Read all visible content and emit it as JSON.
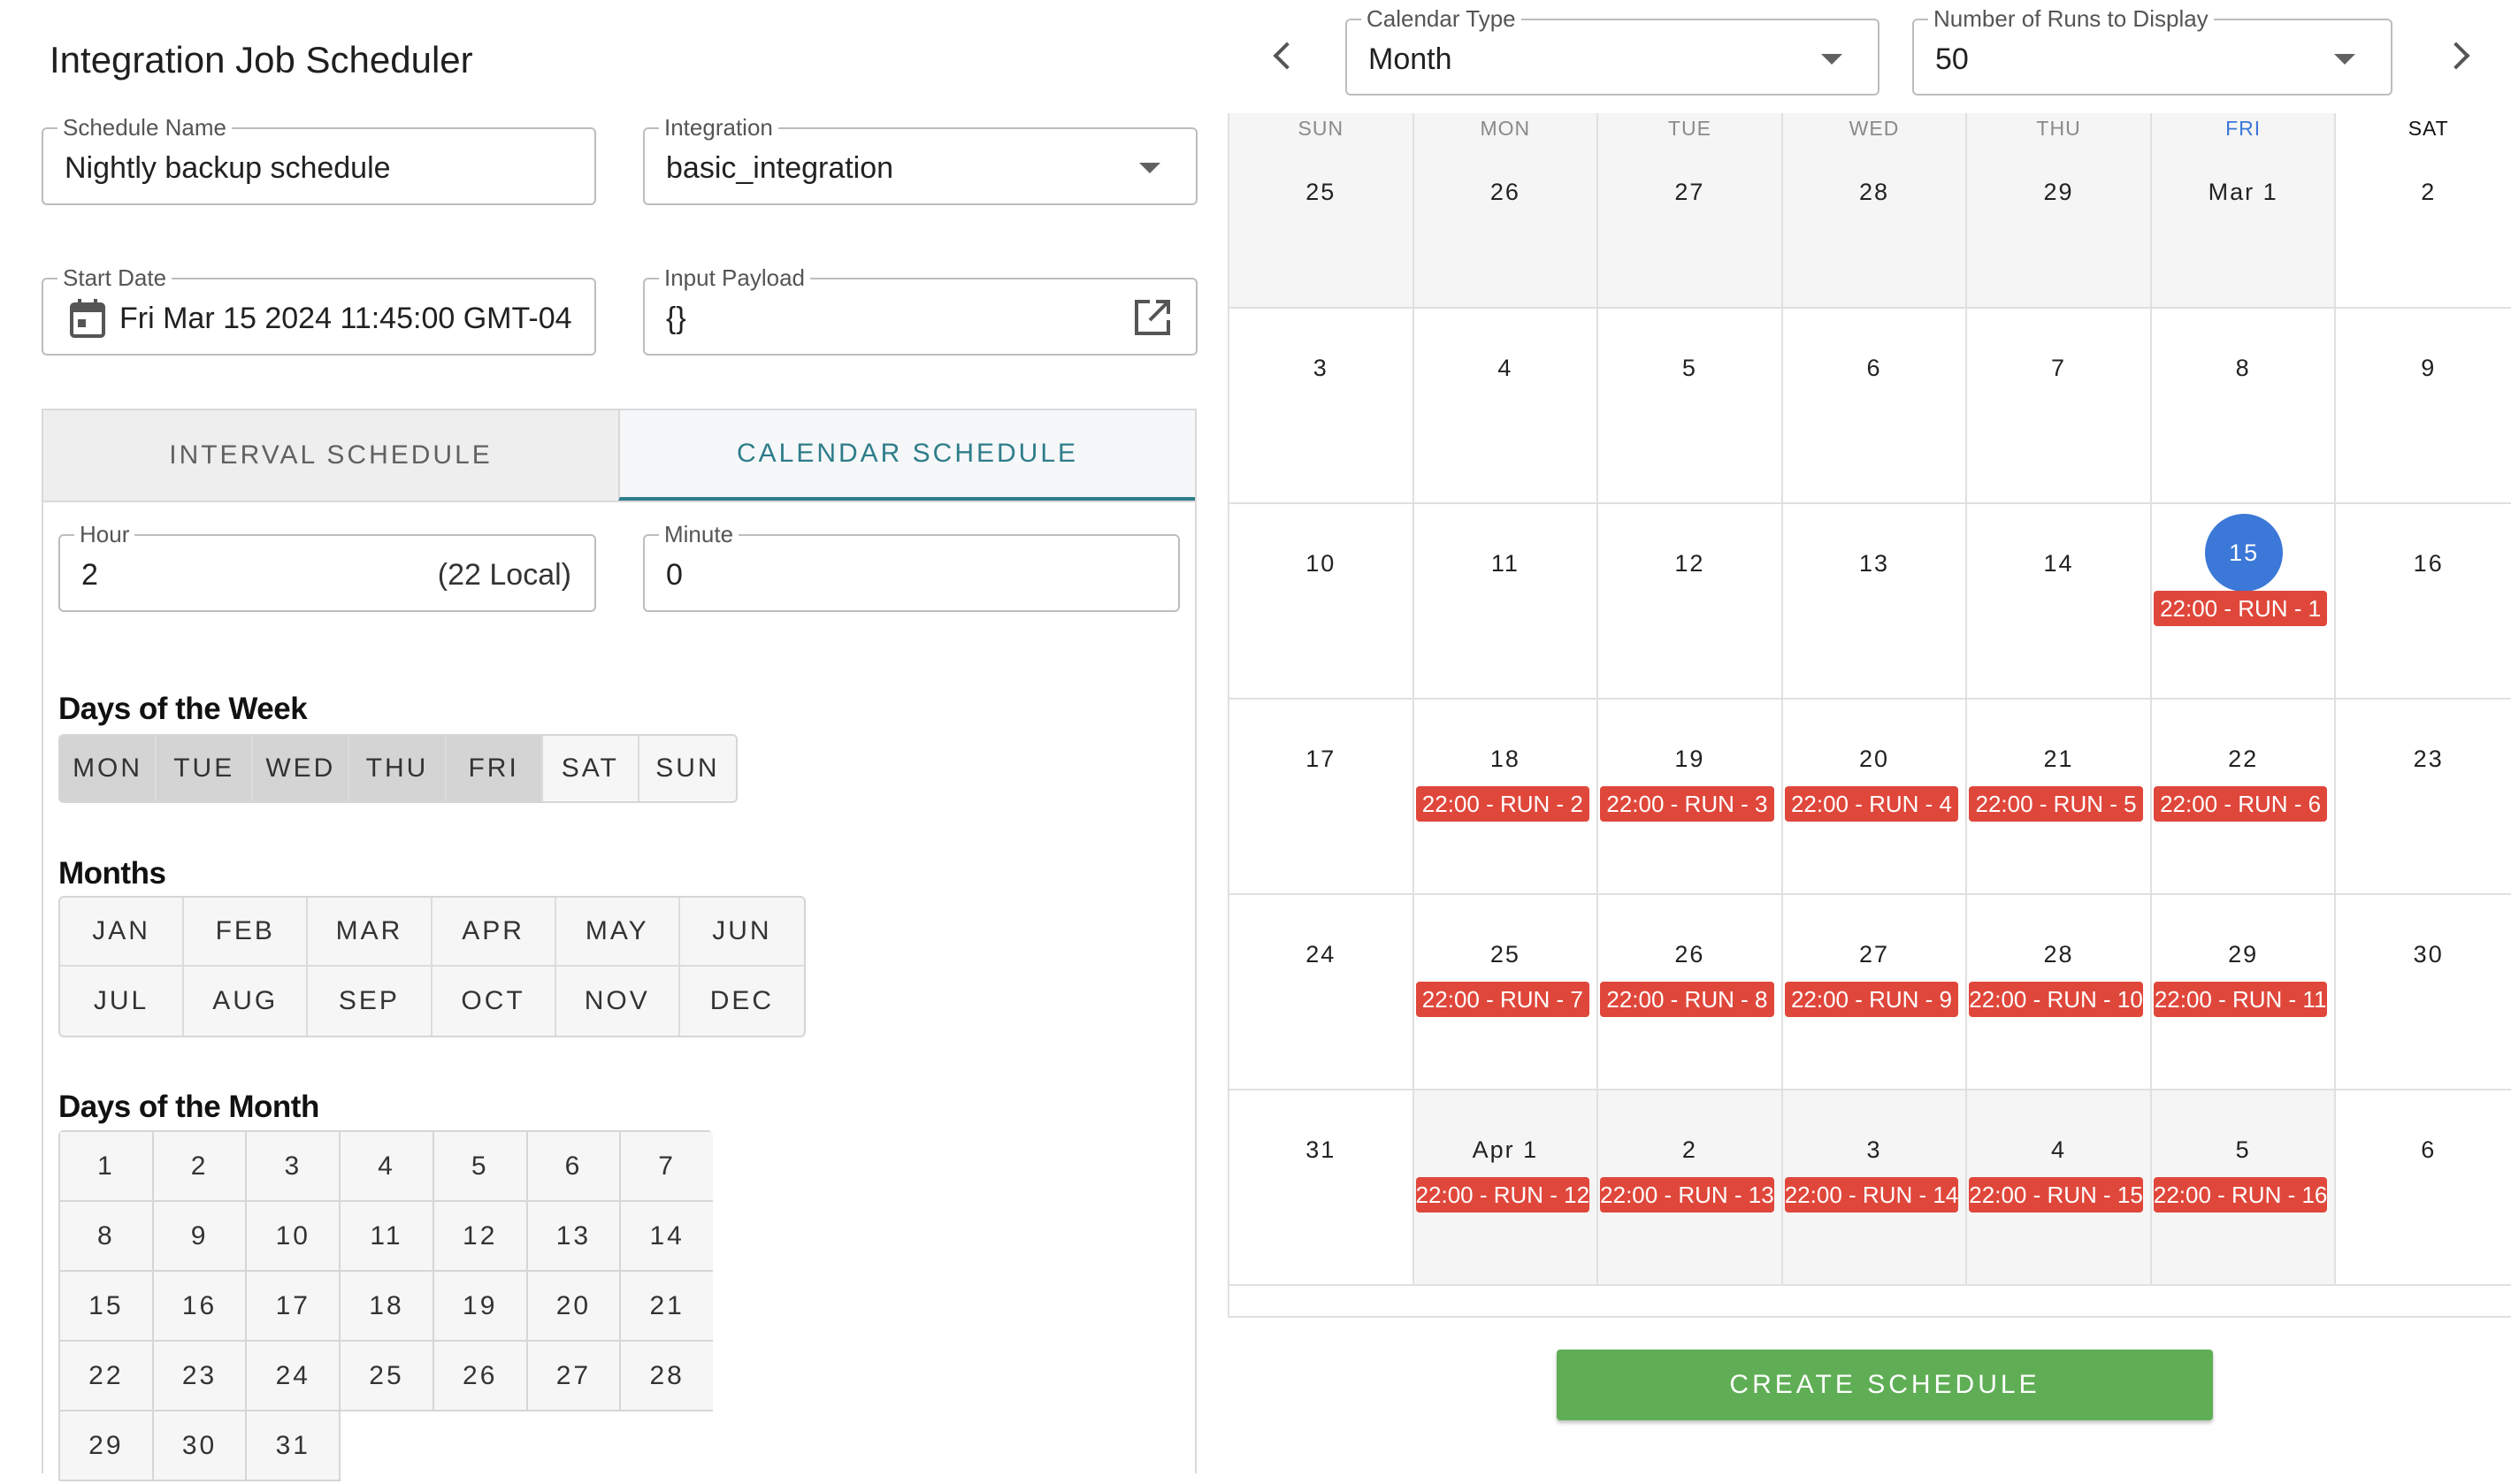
{
  "title": "Integration Job Scheduler",
  "fields": {
    "schedule_name": {
      "label": "Schedule Name",
      "value": "Nightly backup schedule"
    },
    "integration": {
      "label": "Integration",
      "value": "basic_integration"
    },
    "start_date": {
      "label": "Start Date",
      "value": "Fri Mar 15 2024 11:45:00 GMT-04"
    },
    "input_payload": {
      "label": "Input Payload",
      "value": "{}"
    },
    "hour": {
      "label": "Hour",
      "value": "2",
      "local": "(22 Local)"
    },
    "minute": {
      "label": "Minute",
      "value": "0"
    },
    "calendar_type": {
      "label": "Calendar Type",
      "value": "Month"
    },
    "runs_to_display": {
      "label": "Number of Runs to Display",
      "value": "50"
    }
  },
  "tabs": {
    "interval": "INTERVAL SCHEDULE",
    "calendar": "CALENDAR SCHEDULE",
    "active": "calendar"
  },
  "sections": {
    "days_of_week": "Days of the Week",
    "months": "Months",
    "days_of_month": "Days of the Month"
  },
  "days_of_week": [
    {
      "label": "MON",
      "selected": true
    },
    {
      "label": "TUE",
      "selected": true
    },
    {
      "label": "WED",
      "selected": true
    },
    {
      "label": "THU",
      "selected": true
    },
    {
      "label": "FRI",
      "selected": true
    },
    {
      "label": "SAT",
      "selected": false
    },
    {
      "label": "SUN",
      "selected": false
    }
  ],
  "months": [
    "JAN",
    "FEB",
    "MAR",
    "APR",
    "MAY",
    "JUN",
    "JUL",
    "AUG",
    "SEP",
    "OCT",
    "NOV",
    "DEC"
  ],
  "days_of_month": [
    "1",
    "2",
    "3",
    "4",
    "5",
    "6",
    "7",
    "8",
    "9",
    "10",
    "11",
    "12",
    "13",
    "14",
    "15",
    "16",
    "17",
    "18",
    "19",
    "20",
    "21",
    "22",
    "23",
    "24",
    "25",
    "26",
    "27",
    "28",
    "29",
    "30",
    "31"
  ],
  "calendar": {
    "weekdays": [
      "SUN",
      "MON",
      "TUE",
      "WED",
      "THU",
      "FRI",
      "SAT"
    ],
    "today_column": 5,
    "accent_color": "#3b78d8",
    "event_color": "#e0473b",
    "weeks": [
      [
        {
          "d": "25",
          "m": true
        },
        {
          "d": "26",
          "m": true
        },
        {
          "d": "27",
          "m": true
        },
        {
          "d": "28",
          "m": true
        },
        {
          "d": "29",
          "m": true
        },
        {
          "d": "Mar 1",
          "m": true,
          "td": true
        },
        {
          "d": "2"
        }
      ],
      [
        {
          "d": "3"
        },
        {
          "d": "4"
        },
        {
          "d": "5"
        },
        {
          "d": "6"
        },
        {
          "d": "7"
        },
        {
          "d": "8"
        },
        {
          "d": "9"
        }
      ],
      [
        {
          "d": "10"
        },
        {
          "d": "11"
        },
        {
          "d": "12"
        },
        {
          "d": "13"
        },
        {
          "d": "14"
        },
        {
          "d": "15",
          "today": true,
          "ev": "22:00 - RUN - 1"
        },
        {
          "d": "16"
        }
      ],
      [
        {
          "d": "17"
        },
        {
          "d": "18",
          "ev": "22:00 - RUN - 2"
        },
        {
          "d": "19",
          "ev": "22:00 - RUN - 3"
        },
        {
          "d": "20",
          "ev": "22:00 - RUN - 4"
        },
        {
          "d": "21",
          "ev": "22:00 - RUN - 5"
        },
        {
          "d": "22",
          "ev": "22:00 - RUN - 6"
        },
        {
          "d": "23"
        }
      ],
      [
        {
          "d": "24"
        },
        {
          "d": "25",
          "ev": "22:00 - RUN - 7"
        },
        {
          "d": "26",
          "ev": "22:00 - RUN - 8"
        },
        {
          "d": "27",
          "ev": "22:00 - RUN - 9"
        },
        {
          "d": "28",
          "ev": "22:00 - RUN - 10"
        },
        {
          "d": "29",
          "ev": "22:00 - RUN - 11"
        },
        {
          "d": "30"
        }
      ],
      [
        {
          "d": "31"
        },
        {
          "d": "Apr 1",
          "m": true,
          "ev": "22:00 - RUN - 12"
        },
        {
          "d": "2",
          "m": true,
          "ev": "22:00 - RUN - 13"
        },
        {
          "d": "3",
          "m": true,
          "ev": "22:00 - RUN - 14"
        },
        {
          "d": "4",
          "m": true,
          "ev": "22:00 - RUN - 15"
        },
        {
          "d": "5",
          "m": true,
          "ev": "22:00 - RUN - 16"
        },
        {
          "d": "6"
        }
      ]
    ]
  },
  "create_button": "CREATE SCHEDULE"
}
